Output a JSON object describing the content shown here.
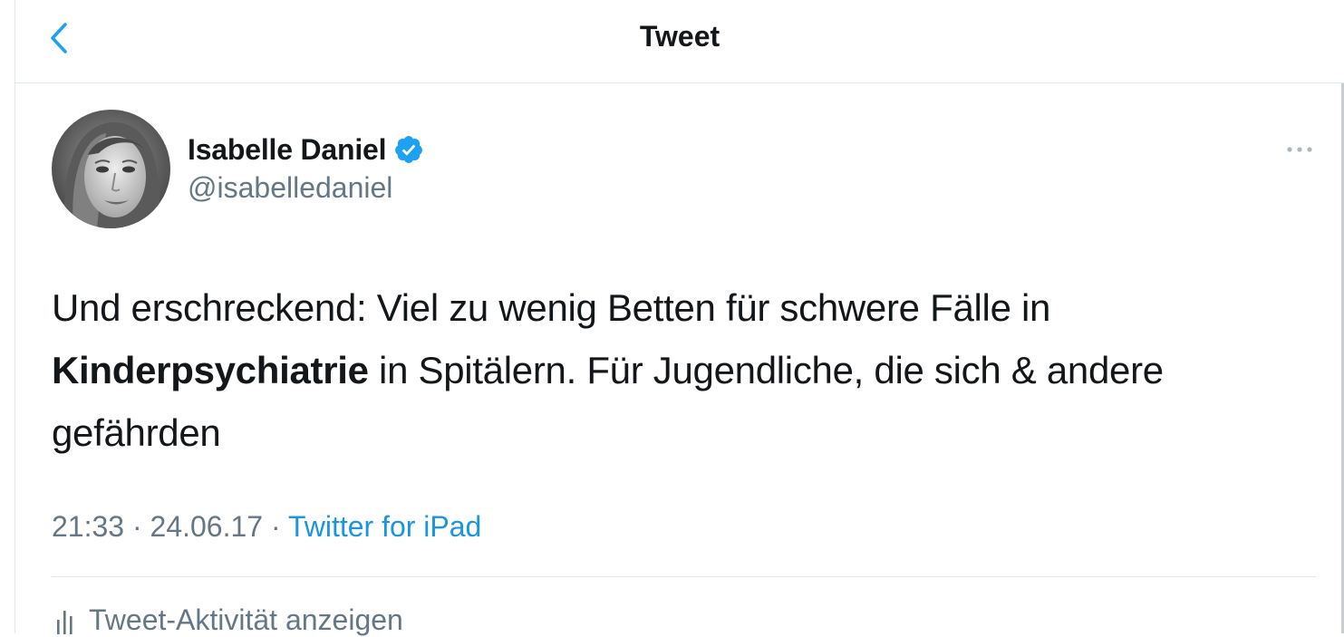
{
  "header": {
    "title": "Tweet"
  },
  "tweet": {
    "author": {
      "display_name": "Isabelle Daniel",
      "handle": "@isabelledaniel",
      "verified": true
    },
    "text": {
      "part1": "Und erschreckend: Viel zu wenig Betten für schwere Fälle in ",
      "bold": "Kinderpsychiatrie",
      "part2": " in Spitälern. Für Jugendliche, die sich & andere gefährden"
    },
    "meta": {
      "time": "21:33",
      "separator1": " · ",
      "date": "24.06.17",
      "separator2": " · ",
      "source": "Twitter for iPad"
    },
    "activity_label": "Tweet-Aktivität anzeigen"
  },
  "colors": {
    "accent": "#1b95e0",
    "text_primary": "#14171a",
    "text_secondary": "#657786",
    "divider": "#e1e8ed",
    "verified": "#1da1f2"
  }
}
